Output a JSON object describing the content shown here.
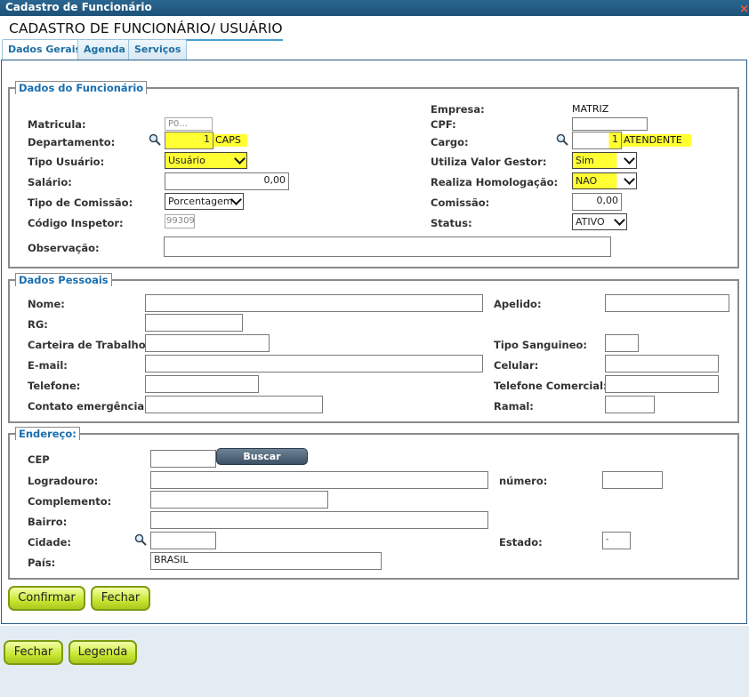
{
  "window": {
    "title": "Cadastro de Funcionário",
    "close_glyph": "×"
  },
  "page": {
    "title": "CADASTRO DE FUNCIONÁRIO/ USUÁRIO"
  },
  "tabs": [
    {
      "label": "Dados Gerais",
      "active": true
    },
    {
      "label": "Agenda",
      "active": false
    },
    {
      "label": "Serviços",
      "active": false
    }
  ],
  "funcionario": {
    "legend": "Dados do Funcionário",
    "empresa_label": "Empresa:",
    "empresa_value": "MATRIZ",
    "matricula_label": "Matricula:",
    "matricula_value": "P0...",
    "cpf_label": "CPF:",
    "cpf_value": "",
    "departamento_label": "Departamento:",
    "departamento_code": "1",
    "departamento_name": "CAPS",
    "cargo_label": "Cargo:",
    "cargo_code": "1",
    "cargo_name": "ATENDENTE",
    "tipo_usuario_label": "Tipo Usuário:",
    "tipo_usuario_value": "Usuário",
    "valor_gestor_label": "Utiliza Valor Gestor:",
    "valor_gestor_value": "Sim",
    "salario_label": "Salário:",
    "salario_value": "0,00",
    "homologacao_label": "Realiza Homologação:",
    "homologacao_value": "NAO",
    "tipo_comissao_label": "Tipo de Comissão:",
    "tipo_comissao_value": "Porcentagem",
    "comissao_label": "Comissão:",
    "comissao_value": "0,00",
    "codigo_inspetor_label": "Código Inspetor:",
    "codigo_inspetor_value": "99309",
    "status_label": "Status:",
    "status_value": "ATIVO",
    "observacao_label": "Observação:",
    "observacao_value": ""
  },
  "pessoais": {
    "legend": "Dados Pessoais",
    "nome_label": "Nome:",
    "apelido_label": "Apelido:",
    "rg_label": "RG:",
    "carteira_label": "Carteira de Trabalho:",
    "tipo_sanguineo_label": "Tipo Sanguineo:",
    "email_label": "E-mail:",
    "celular_label": "Celular:",
    "telefone_label": "Telefone:",
    "telefone_comercial_label": "Telefone Comercial:",
    "contato_label": "Contato emergência:",
    "ramal_label": "Ramal:"
  },
  "endereco": {
    "legend": "Endereço:",
    "cep_label": "CEP",
    "buscar_label": "Buscar Endereco",
    "logradouro_label": "Logradouro:",
    "numero_label": "número:",
    "complemento_label": "Complemento:",
    "bairro_label": "Bairro:",
    "cidade_label": "Cidade:",
    "estado_label": "Estado:",
    "estado_value": "-",
    "pais_label": "País:",
    "pais_value": "BRASIL"
  },
  "buttons": {
    "confirmar": "Confirmar",
    "fechar_inner": "Fechar",
    "fechar_outer": "Fechar",
    "legenda": "Legenda"
  },
  "icons": {
    "search": "magnifier-icon",
    "dropdown": "chevron-down-icon",
    "close": "close-icon"
  },
  "colors": {
    "title_bar": "#1d5278",
    "legend_text": "#1a6fb0",
    "highlight": "#ffff33",
    "button_green": "#c8e632"
  }
}
